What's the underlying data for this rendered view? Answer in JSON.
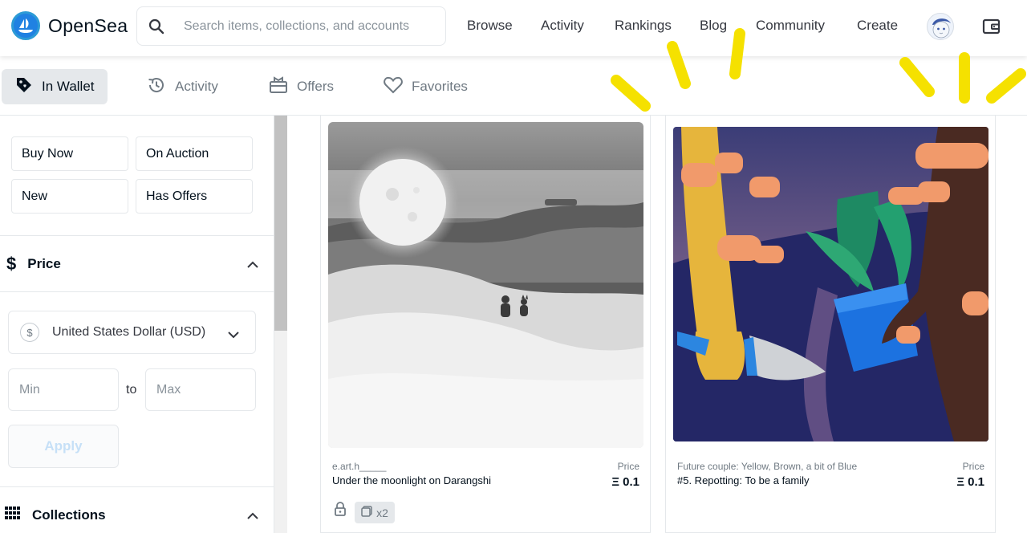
{
  "brand": {
    "name": "OpenSea",
    "accent": "#2081e2"
  },
  "search": {
    "placeholder": "Search items, collections, and accounts",
    "icon": "search-icon"
  },
  "nav": {
    "links": [
      "Browse",
      "Activity",
      "Rankings",
      "Blog",
      "Community",
      "Create"
    ],
    "avatar_icon": "avatar",
    "wallet_icon": "wallet-icon"
  },
  "tabs": [
    {
      "label": "In Wallet",
      "icon": "tag-icon",
      "active": true
    },
    {
      "label": "Activity",
      "icon": "history-icon",
      "active": false
    },
    {
      "label": "Offers",
      "icon": "gift-icon",
      "active": false
    },
    {
      "label": "Favorites",
      "icon": "heart-icon",
      "active": false
    }
  ],
  "filters": {
    "status": [
      "Buy Now",
      "On Auction",
      "New",
      "Has Offers"
    ],
    "price": {
      "label": "Price",
      "currency": "United States Dollar (USD)",
      "currency_symbol": "$",
      "min_placeholder": "Min",
      "max_placeholder": "Max",
      "to_label": "to",
      "apply_label": "Apply"
    },
    "collections": {
      "label": "Collections"
    }
  },
  "items": [
    {
      "creator": "e.art.h_____",
      "title": "Under the moonlight on Darangshi",
      "price_label": "Price",
      "price": "0.1",
      "currency_symbol": "Ξ",
      "quantity": "x2"
    },
    {
      "creator": "Future couple: Yellow, Brown, a bit of Blue",
      "title": "#5. Repotting: To be a family",
      "price_label": "Price",
      "price": "0.1",
      "currency_symbol": "Ξ"
    }
  ],
  "highlight_color": "#f5e100"
}
